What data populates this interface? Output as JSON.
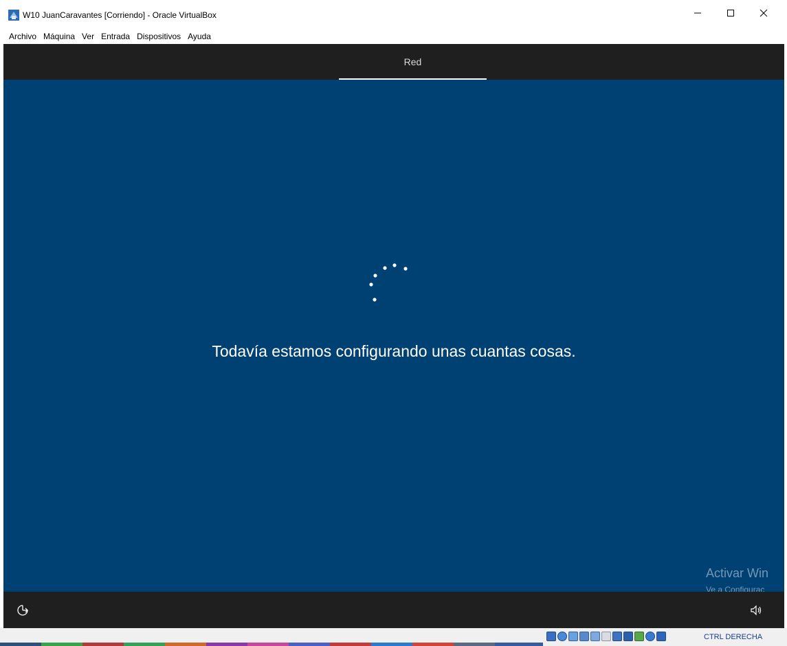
{
  "window": {
    "title": "W10 JuanCaravantes [Corriendo] - Oracle VirtualBox",
    "controls": {
      "minimize": "minimize-icon",
      "maximize": "maximize-icon",
      "close": "close-icon"
    }
  },
  "menubar": {
    "items": [
      "Archivo",
      "Máquina",
      "Ver",
      "Entrada",
      "Dispositivos",
      "Ayuda"
    ]
  },
  "oobe": {
    "step_label": "Red",
    "message": "Todavía estamos configurando unas cuantas cosas.",
    "watermark_title": "Activar Win",
    "watermark_subtitle": "Ve a Configurac",
    "footer_left_icon": "ease-of-access-icon",
    "footer_right_icon": "volume-icon"
  },
  "statusbar": {
    "host_key_label": "CTRL DERECHA",
    "icons": [
      "hard-disk-icon",
      "optical-drive-icon",
      "audio-icon",
      "network-icon",
      "usb-icon",
      "shared-folders-icon",
      "display-icon",
      "recording-icon",
      "cpu-icon",
      "mouse-integration-icon",
      "keyboard-icon"
    ]
  },
  "colors": {
    "oobe_background": "#004174",
    "oobe_bars": "#1f1f1f",
    "host_key_text": "#1a3b8c"
  }
}
